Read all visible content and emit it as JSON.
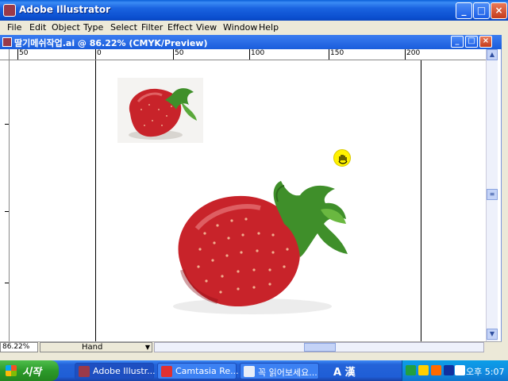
{
  "app": {
    "title": "Adobe Illustrator",
    "controls": {
      "minimize": "_",
      "maximize": "□",
      "close": "×"
    }
  },
  "menu": [
    "File",
    "Edit",
    "Object",
    "Type",
    "Select",
    "Filter",
    "Effect",
    "View",
    "Window",
    "Help"
  ],
  "document": {
    "title": "딸기메쉬작업.ai @ 86.22% (CMYK/Preview)",
    "ruler_labels": [
      "50",
      "0",
      "50",
      "100",
      "150",
      "200"
    ]
  },
  "status": {
    "zoom": "86.22%",
    "tool": "Hand"
  },
  "taskbar": {
    "start_label": "시작",
    "tasks": [
      {
        "label": "Adobe Illustr...",
        "active": true
      },
      {
        "label": "Camtasia Re...",
        "active": false
      },
      {
        "label": "꼭 읽어보세요...",
        "active": false
      }
    ],
    "ime": "A 漢",
    "clock": "오후 5:07"
  },
  "colors": {
    "titlebar": "#1a63e0",
    "start_green": "#2c9a2a",
    "strawberry": "#c8232a"
  },
  "icons": {
    "cursor": "hand-cursor-icon"
  }
}
